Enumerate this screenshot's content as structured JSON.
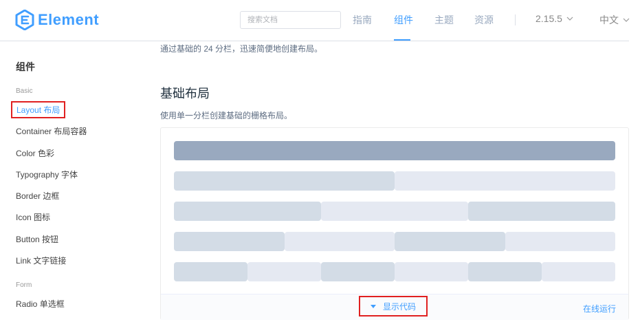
{
  "header": {
    "logo_text": "Element",
    "search_placeholder": "搜索文档",
    "nav": [
      "指南",
      "组件",
      "主题",
      "资源"
    ],
    "version": "2.15.5",
    "language": "中文"
  },
  "sidebar": {
    "title": "组件",
    "group_basic": "Basic",
    "items": [
      "Layout 布局",
      "Container 布局容器",
      "Color 色彩",
      "Typography 字体",
      "Border 边框",
      "Icon 图标",
      "Button 按钮",
      "Link 文字链接"
    ],
    "group_form": "Form",
    "form_items": [
      "Radio 单选框"
    ]
  },
  "main": {
    "intro": "通过基础的 24 分栏，迅速简便地创建布局。",
    "section_title": "基础布局",
    "section_desc": "使用单一分栏创建基础的栅格布局。",
    "rows": [
      [
        "dark"
      ],
      [
        "mid",
        "light"
      ],
      [
        "mid",
        "light",
        "mid"
      ],
      [
        "mid",
        "light",
        "mid",
        "light"
      ],
      [
        "mid",
        "light",
        "mid",
        "light",
        "mid",
        "light"
      ]
    ],
    "show_code": "显示代码",
    "run_online": "在线运行"
  },
  "colors": {
    "accent": "#409eff",
    "highlight_border": "#e02020",
    "col_dark": "#99a9bf",
    "col_mid": "#d3dce6",
    "col_light": "#e5e9f2"
  }
}
